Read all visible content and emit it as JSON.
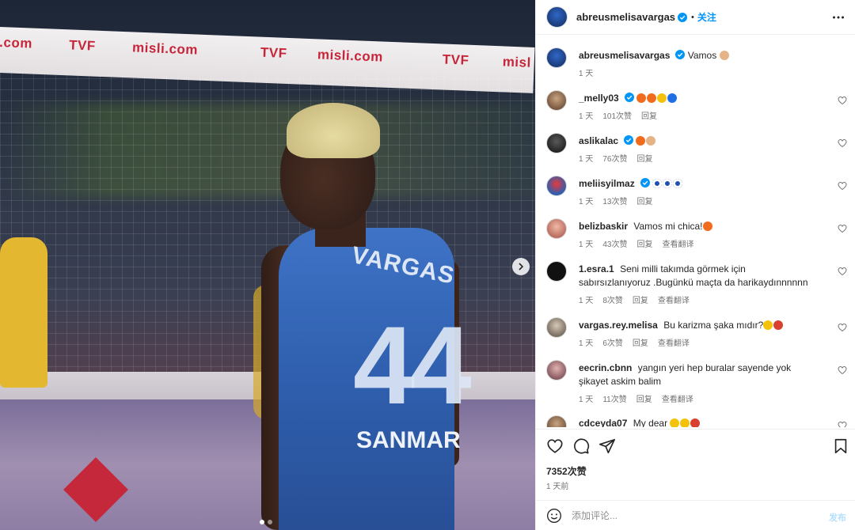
{
  "photo": {
    "banner_texts": [
      ".com",
      "TVF",
      "misli.com",
      "TVF",
      "misli.com",
      "TVF",
      "misl"
    ],
    "jersey_name": "VARGAS",
    "jersey_number": "44",
    "jersey_sponsor": "SANMAR",
    "carousel_position": 1,
    "carousel_count": 2
  },
  "header": {
    "username": "abreusmelisavargas",
    "separator": "•",
    "follow_label": "关注"
  },
  "caption": {
    "username": "abreusmelisavargas",
    "text": "Vamos",
    "time": "1 天"
  },
  "comments": [
    {
      "username": "_melly03",
      "verified": true,
      "text": "",
      "emojis": [
        "#f26b1d",
        "#f26b1d",
        "#f4c20d",
        "#1f6fe5"
      ],
      "time": "1 天",
      "likes": "101次赞",
      "reply": "回复",
      "translate": ""
    },
    {
      "username": "aslikalac",
      "verified": true,
      "text": "",
      "emojis": [
        "#f26b1d",
        "#e6b387"
      ],
      "time": "1 天",
      "likes": "76次赞",
      "reply": "回复",
      "translate": ""
    },
    {
      "username": "meliisyilmaz",
      "verified": true,
      "text": "",
      "emojis": [
        "#1f4fb0",
        "#1f4fb0",
        "#1f4fb0"
      ],
      "time": "1 天",
      "likes": "13次赞",
      "reply": "回复",
      "translate": ""
    },
    {
      "username": "belizbaskir",
      "verified": false,
      "text": "Vamos mi chica!",
      "emojis": [
        "#f26b1d"
      ],
      "time": "1 天",
      "likes": "43次赞",
      "reply": "回复",
      "translate": "查看翻译"
    },
    {
      "username": "1.esra.1",
      "verified": false,
      "text": "Seni milli takımda görmek için sabırsızlanıyoruz .Bugünkü maçta da harikaydınnnnnn",
      "emojis": [],
      "time": "1 天",
      "likes": "8次赞",
      "reply": "回复",
      "translate": "查看翻译"
    },
    {
      "username": "vargas.rey.melisa",
      "verified": false,
      "text": "Bu karizma şaka mıdır?",
      "emojis": [
        "#f4c20d",
        "#d8412f"
      ],
      "time": "1 天",
      "likes": "6次赞",
      "reply": "回复",
      "translate": "查看翻译"
    },
    {
      "username": "eecrin.cbnn",
      "verified": false,
      "text": "yangın yeri hep buralar sayende yok şikayet askim balim",
      "emojis": [],
      "time": "1 天",
      "likes": "11次赞",
      "reply": "回复",
      "translate": "查看翻译"
    },
    {
      "username": "cdceyda07",
      "verified": false,
      "text": "My dear",
      "emojis": [
        "#f4c20d",
        "#f4c20d",
        "#d8412f"
      ],
      "time": "",
      "likes": "",
      "reply": "",
      "translate": ""
    }
  ],
  "footer": {
    "likes": "7352次赞",
    "time": "1 天前",
    "comment_placeholder": "添加评论...",
    "post_label": "发布"
  },
  "colors": {
    "link": "#0095f6",
    "verified": "#0095f6",
    "muted": "#737373"
  }
}
